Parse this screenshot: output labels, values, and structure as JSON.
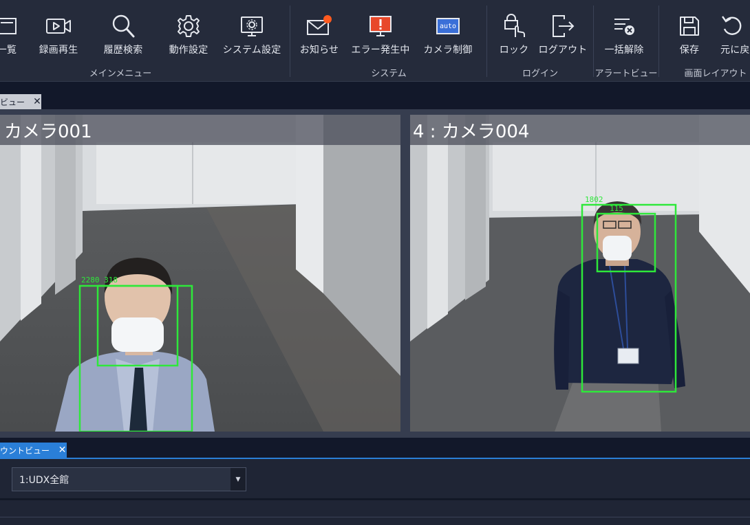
{
  "ribbon": {
    "buttons": [
      {
        "label": "一覧",
        "icon": "list-icon"
      },
      {
        "label": "録画再生",
        "icon": "video-playback-icon"
      },
      {
        "label": "履歴検索",
        "icon": "search-icon"
      },
      {
        "label": "動作設定",
        "icon": "gear-icon"
      },
      {
        "label": "システム設定",
        "icon": "monitor-gear-icon"
      },
      {
        "label": "お知らせ",
        "icon": "mail-icon"
      },
      {
        "label": "エラー発生中",
        "icon": "error-monitor-icon"
      },
      {
        "label": "カメラ制御",
        "icon": "camera-control-icon"
      },
      {
        "label": "ロック",
        "icon": "lock-icon"
      },
      {
        "label": "ログアウト",
        "icon": "logout-icon"
      },
      {
        "label": "一括解除",
        "icon": "clear-all-icon"
      },
      {
        "label": "保存",
        "icon": "save-icon"
      },
      {
        "label": "元に戻",
        "icon": "undo-icon"
      }
    ],
    "groups": {
      "main_menu": "メインメニュー",
      "system": "システム",
      "login": "ログイン",
      "alert_view": "アラートビュー",
      "screen_layout": "画面レイアウト"
    },
    "camera_control_badge": "auto",
    "notification_dot_color": "#ff5a1f",
    "error_color": "#e8482a"
  },
  "view_tab": {
    "label": "ビュー",
    "close": "✕"
  },
  "cameras": [
    {
      "title": "カメラ001",
      "box_label": "2280 318"
    },
    {
      "title": "4 : カメラ004",
      "box_label_a": "1802",
      "box_label_b": "115"
    }
  ],
  "count_tab": {
    "label": "ウントビュー",
    "close": "✕"
  },
  "count_select": {
    "value": "1:UDX全館",
    "arrow": "▼"
  },
  "colors": {
    "accent": "#2a7fd8",
    "detection_box": "#2ee83a"
  }
}
